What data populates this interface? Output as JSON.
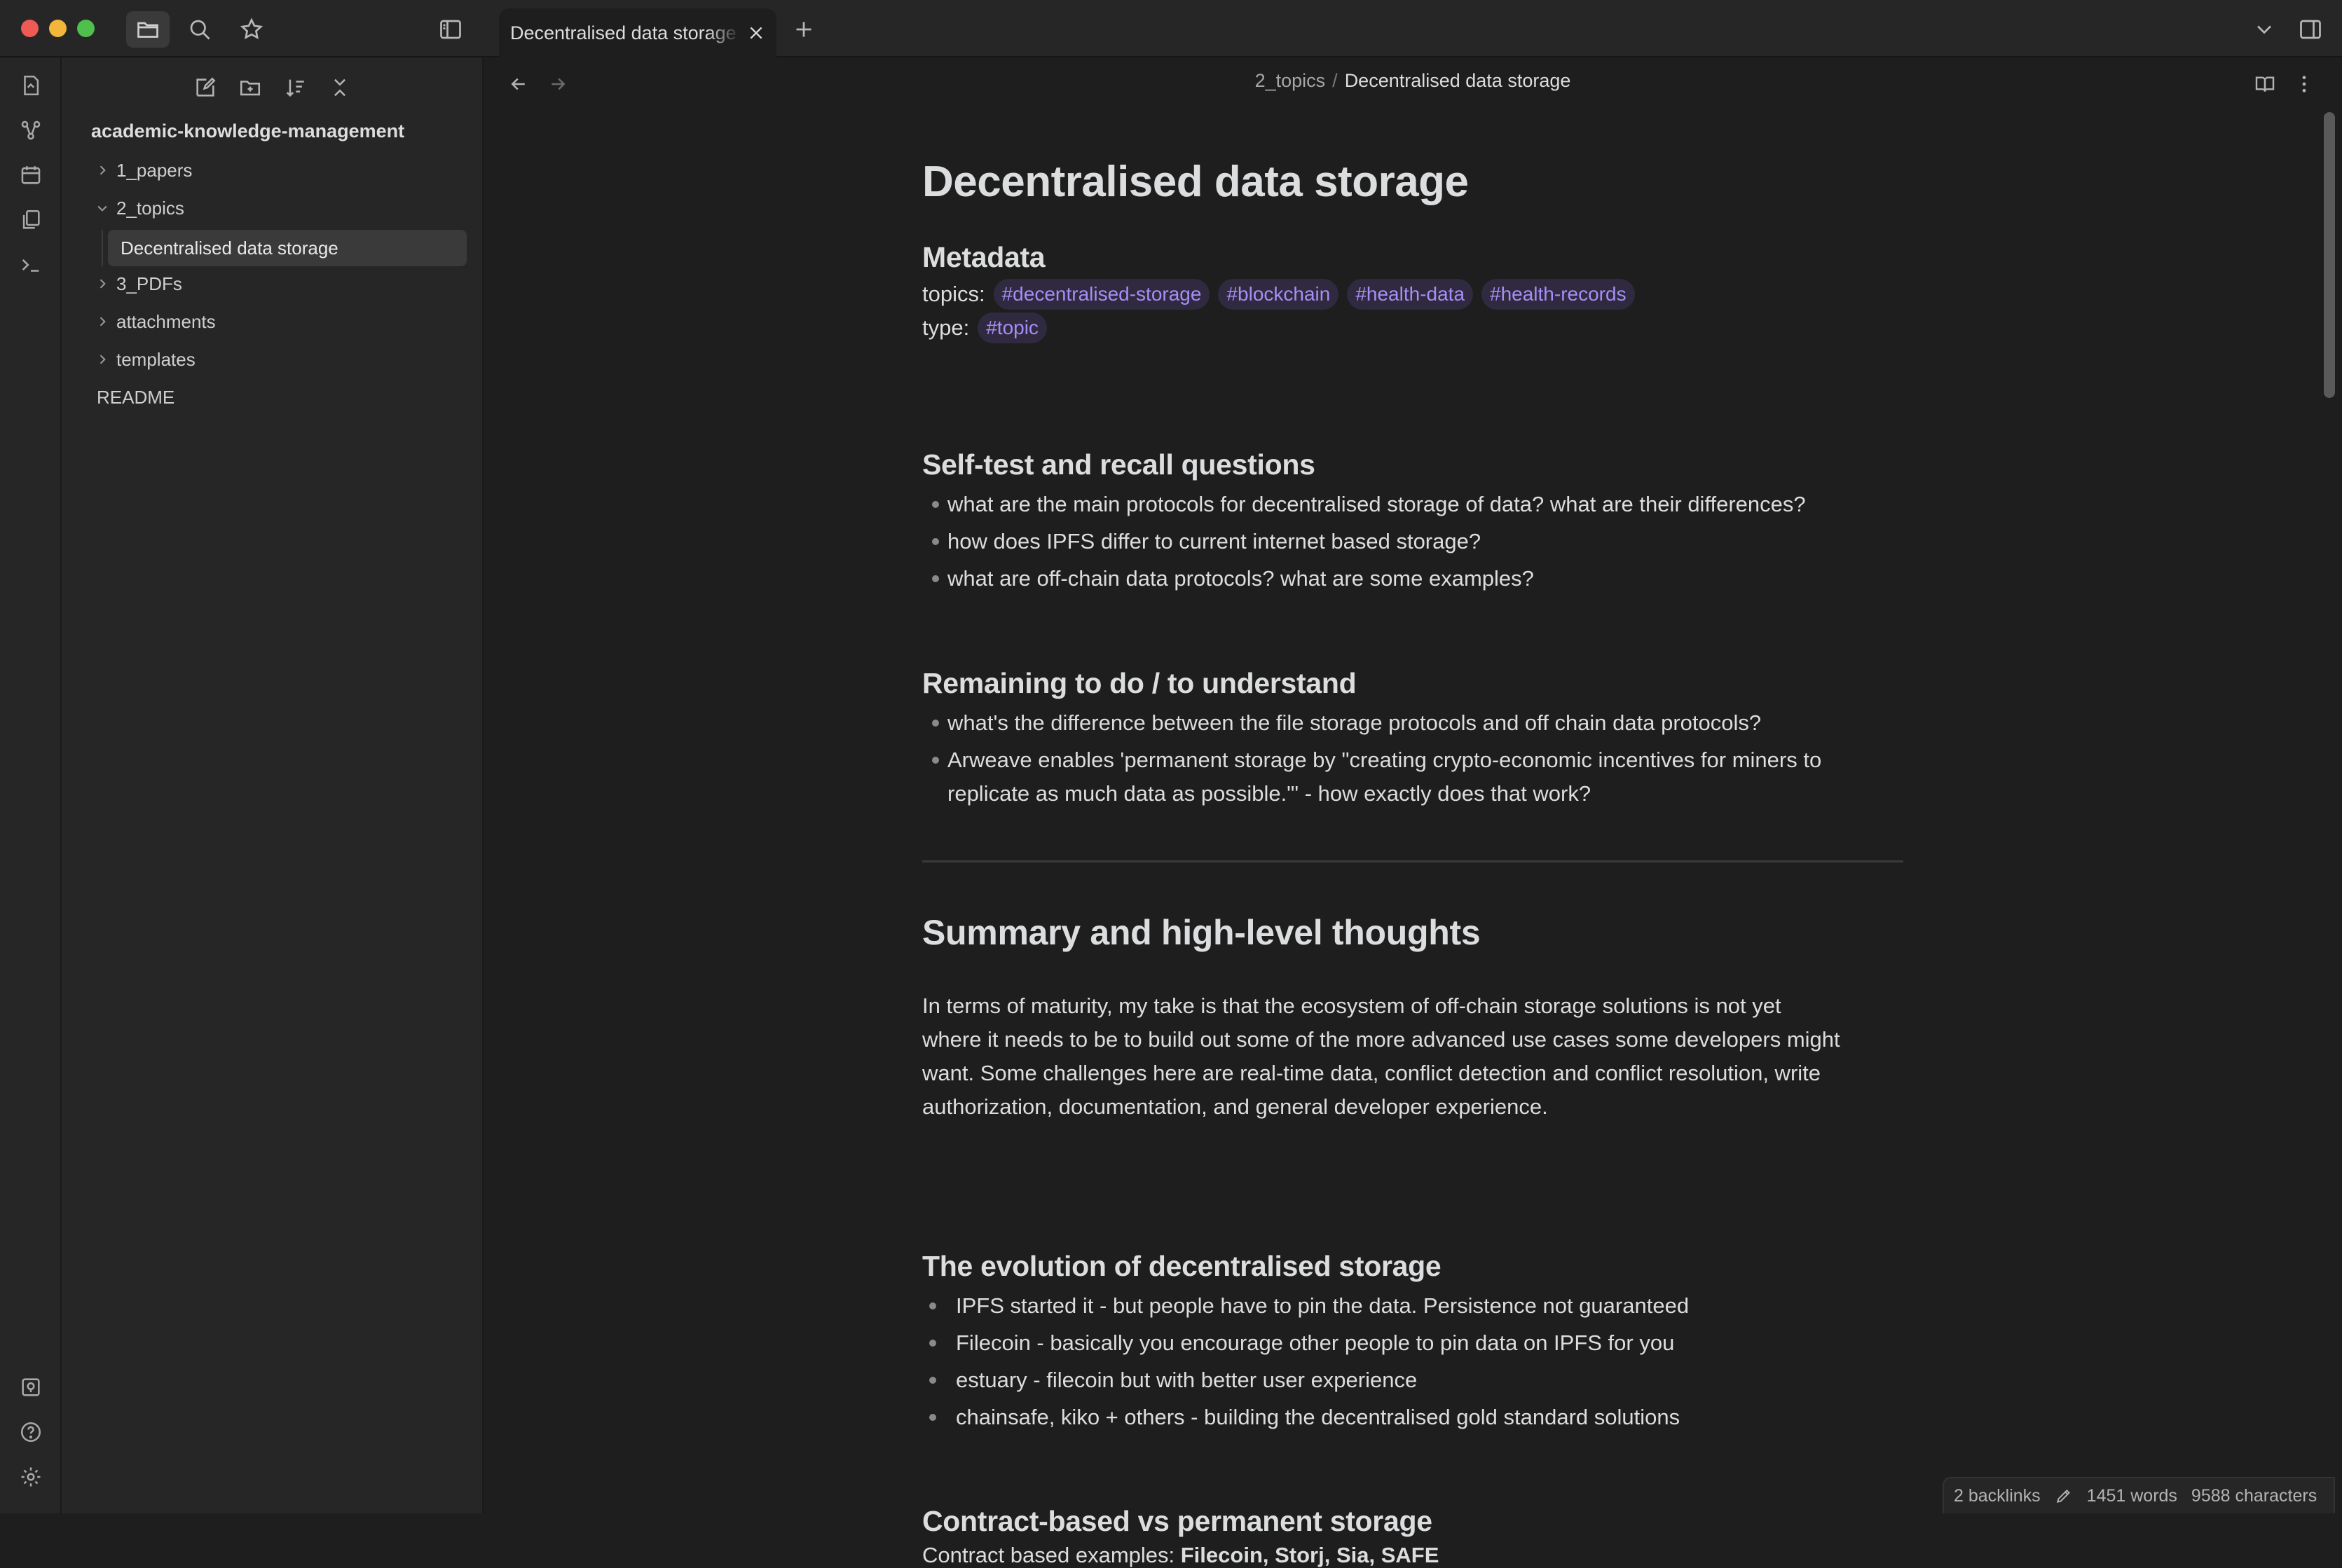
{
  "app": {
    "icons": {
      "files": "folder-icon",
      "search": "search-icon",
      "bookmarks": "star-icon",
      "sidebar_toggle": "sidebar-toggle-icon"
    }
  },
  "tab": {
    "title": "Decentralised data storage",
    "close": "×"
  },
  "ribbon": {
    "top": [
      "open-quick-switcher-icon",
      "graph-view-icon",
      "daily-note-icon",
      "templates-icon",
      "command-palette-icon"
    ],
    "bottom": [
      "open-vault-icon",
      "help-icon",
      "settings-icon"
    ]
  },
  "sidebar": {
    "tools": [
      "new-note-icon",
      "new-folder-icon",
      "sort-icon",
      "collapse-all-icon"
    ],
    "vault_name": "academic-knowledge-management",
    "items": [
      {
        "label": "1_papers",
        "type": "folder",
        "expanded": false
      },
      {
        "label": "2_topics",
        "type": "folder",
        "expanded": true
      },
      {
        "label": "Decentralised data storage",
        "type": "file",
        "active": true
      },
      {
        "label": "3_PDFs",
        "type": "folder",
        "expanded": false
      },
      {
        "label": "attachments",
        "type": "folder",
        "expanded": false
      },
      {
        "label": "templates",
        "type": "folder",
        "expanded": false
      },
      {
        "label": "README",
        "type": "file",
        "active": false
      }
    ]
  },
  "breadcrumb": {
    "parent": "2_topics",
    "separator": "/",
    "current": "Decentralised data storage"
  },
  "doc": {
    "title": "Decentralised data storage",
    "metadata_heading": "Metadata",
    "topics_label": "topics:",
    "topics_tags": [
      "#decentralised-storage",
      "#blockchain",
      "#health-data",
      "#health-records"
    ],
    "type_label": "type:",
    "type_tags": [
      "#topic"
    ],
    "selftest_heading": "Self-test and recall questions",
    "selftest_items": [
      "what are the main protocols for decentralised storage of data? what are their differences?",
      "how does IPFS differ to current internet based storage?",
      "what are off-chain data protocols? what are some examples?"
    ],
    "remaining_heading": "Remaining to do / to understand",
    "remaining_items": [
      "what's the difference between the file storage protocols and off chain data protocols?",
      "Arweave enables 'permanent storage by \"creating crypto-economic incentives for miners to",
      "replicate as much data as possible.\"' - how exactly does that work?"
    ],
    "summary_heading": "Summary and high-level thoughts",
    "summary_lines": [
      "In terms of maturity, my take is that the ecosystem of off-chain storage solutions is not yet",
      "where it needs to be to build out some of the more advanced use cases some developers might",
      "want. Some challenges here are real-time data, conflict detection and conflict resolution, write",
      "authorization, documentation, and general developer experience."
    ],
    "evolution_heading": "The evolution of decentralised storage",
    "evolution_items": [
      "IPFS started it - but people have to pin the data. Persistence not guaranteed",
      "Filecoin - basically you encourage other people to pin data on IPFS for you",
      "estuary - filecoin but with better user experience",
      "chainsafe, kiko + others - building the decentralised gold standard solutions"
    ],
    "contract_heading": "Contract-based vs permanent storage",
    "contract_prefix": "Contract based examples: ",
    "contract_bold": "Filecoin, Storj, Sia, SAFE"
  },
  "status_bar": {
    "backlinks": "2 backlinks",
    "words": "1451 words",
    "characters": "9588 characters"
  },
  "colors": {
    "background": "#1e1e1e",
    "panel": "#262626",
    "tag_text": "#a58ef7",
    "tag_bg": "#2f2a3f",
    "text": "#dcddde"
  }
}
